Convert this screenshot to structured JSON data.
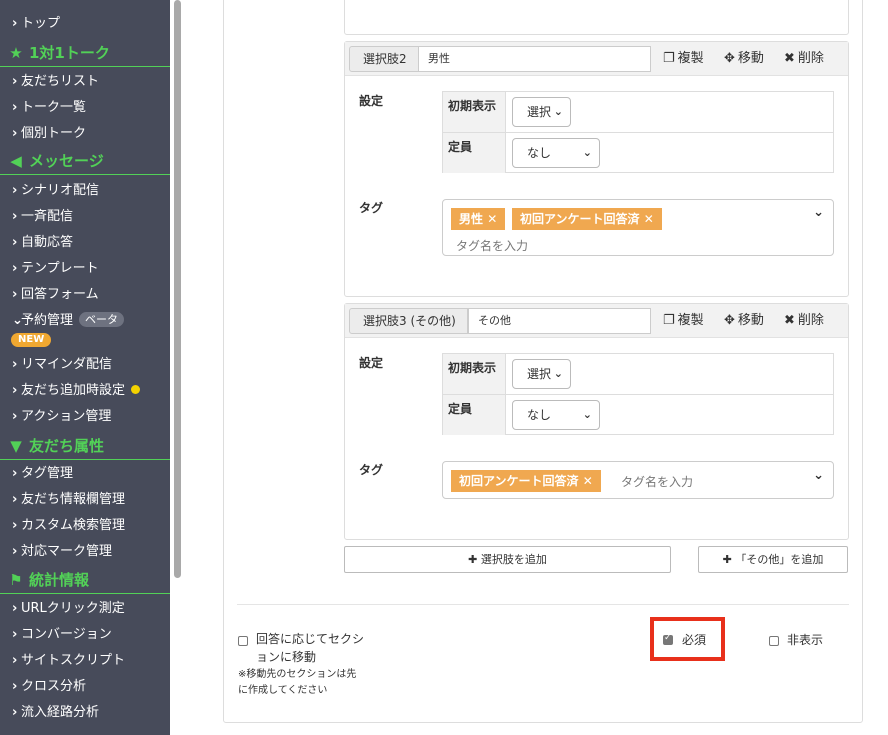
{
  "sidebar": {
    "items_top": [
      {
        "label": "トップ"
      }
    ],
    "section_talk": {
      "title": "1対1トーク",
      "icon": "star-icon"
    },
    "talk_items": [
      {
        "label": "友だちリスト"
      },
      {
        "label": "トーク一覧"
      },
      {
        "label": "個別トーク"
      }
    ],
    "section_message": {
      "title": "メッセージ",
      "icon": "megaphone-icon"
    },
    "message_items": [
      {
        "label": "シナリオ配信"
      },
      {
        "label": "一斉配信"
      },
      {
        "label": "自動応答"
      },
      {
        "label": "テンプレート"
      },
      {
        "label": "回答フォーム"
      },
      {
        "label": "予約管理",
        "badge": "ベータ",
        "new_badge": "NEW"
      },
      {
        "label": "リマインダ配信"
      },
      {
        "label": "友だち追加時設定"
      },
      {
        "label": "アクション管理"
      }
    ],
    "section_attr": {
      "title": "友だち属性",
      "icon": "filter-icon"
    },
    "attr_items": [
      {
        "label": "タグ管理"
      },
      {
        "label": "友だち情報欄管理"
      },
      {
        "label": "カスタム検索管理"
      },
      {
        "label": "対応マーク管理"
      }
    ],
    "section_stats": {
      "title": "統計情報",
      "icon": "flag-icon"
    },
    "stats_items": [
      {
        "label": "URLクリック測定"
      },
      {
        "label": "コンバージョン"
      },
      {
        "label": "サイトスクリプト"
      },
      {
        "label": "クロス分析"
      },
      {
        "label": "流入経路分析"
      }
    ]
  },
  "actions": {
    "copy": "複製",
    "move": "移動",
    "delete": "削除"
  },
  "labels": {
    "settings": "設定",
    "initial_display": "初期表示",
    "capacity": "定員",
    "tags": "タグ"
  },
  "choices": [
    {
      "label": "選択肢2",
      "value": "男性",
      "initial_display": "選択",
      "capacity": "なし",
      "tags": [
        "男性",
        "初回アンケート回答済"
      ],
      "tag_placeholder": "タグ名を入力"
    },
    {
      "label": "選択肢3 (その他)",
      "value": "その他",
      "initial_display": "選択",
      "capacity": "なし",
      "tags": [
        "初回アンケート回答済"
      ],
      "tag_placeholder": "タグ名を入力"
    }
  ],
  "buttons": {
    "add_choice": "選択肢を追加",
    "add_other": "「その他」を追加"
  },
  "options": {
    "move_section": {
      "label": "回答に応じてセクションに移動",
      "line1": "回答に応じてセクシ",
      "line2": "ョンに移動",
      "checked": false
    },
    "move_note_line1": "※移動先のセクションは先",
    "move_note_line2": "に作成してください",
    "required": {
      "label": "必須",
      "checked": true
    },
    "hidden": {
      "label": "非表示",
      "checked": false
    }
  },
  "colors": {
    "sidebar_bg": "#474b5a",
    "accent_green": "#52d157",
    "tag_orange": "#f0a850",
    "highlight_red": "#e8301b"
  }
}
